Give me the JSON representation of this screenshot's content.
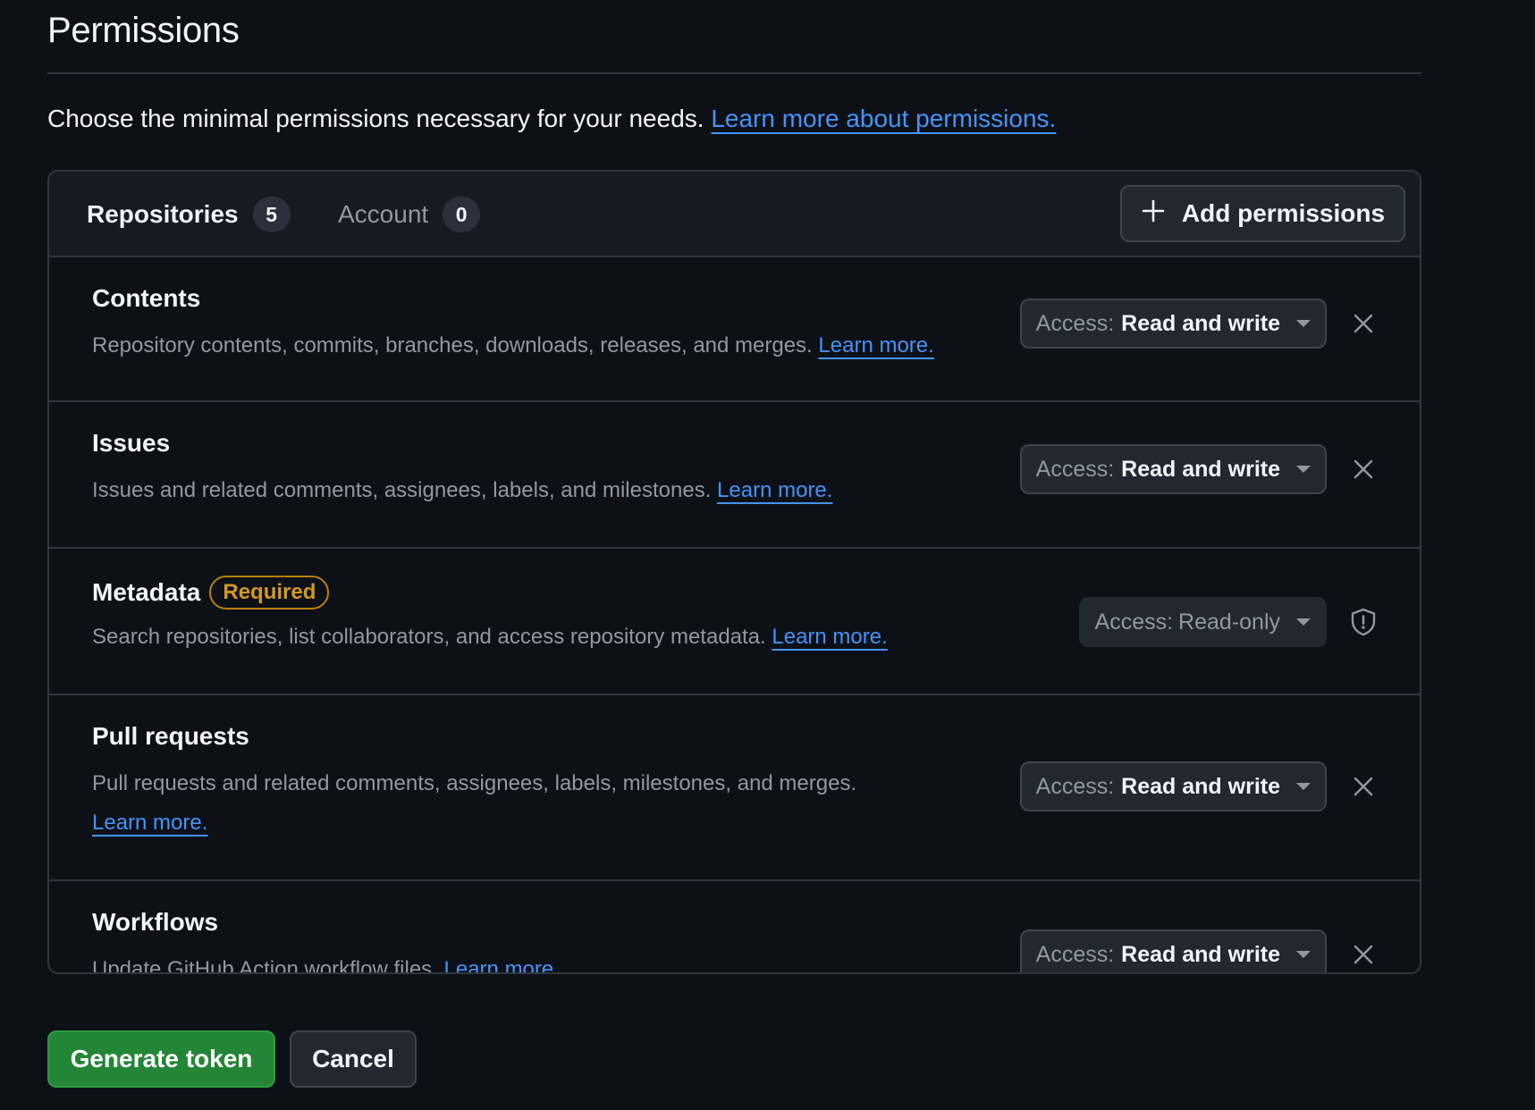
{
  "section": {
    "title": "Permissions",
    "intro_text": "Choose the minimal permissions necessary for your needs.",
    "intro_link": "Learn more about permissions."
  },
  "tabs": [
    {
      "label": "Repositories",
      "count": "5"
    },
    {
      "label": "Account",
      "count": "0"
    }
  ],
  "add_button": {
    "label": "Add permissions",
    "icon": "plus-icon"
  },
  "access_prefix": "Access:",
  "permissions": [
    {
      "name": "Contents",
      "description": "Repository contents, commits, branches, downloads, releases, and merges.",
      "link": "Learn more.",
      "access": "Read and write",
      "action_icon": "close-icon"
    },
    {
      "name": "Issues",
      "description": "Issues and related comments, assignees, labels, and milestones.",
      "link": "Learn more.",
      "access": "Read and write",
      "action_icon": "close-icon"
    },
    {
      "name": "Metadata",
      "badge": "Required",
      "description": "Search repositories, list collaborators, and access repository metadata.",
      "link": "Learn more.",
      "access": "Read-only",
      "action_icon": "shield-icon"
    },
    {
      "name": "Pull requests",
      "description": "Pull requests and related comments, assignees, labels, milestones, and merges.",
      "link": "Learn more.",
      "access": "Read and write",
      "action_icon": "close-icon"
    },
    {
      "name": "Workflows",
      "description": "Update GitHub Action workflow files.",
      "link": "Learn more.",
      "access": "Read and write",
      "action_icon": "close-icon"
    }
  ],
  "buttons": {
    "generate": "Generate token",
    "cancel": "Cancel"
  },
  "colors": {
    "background": "#0d1117",
    "link": "#4493f8",
    "primary_button": "#238636",
    "required_badge": "#d29922"
  }
}
